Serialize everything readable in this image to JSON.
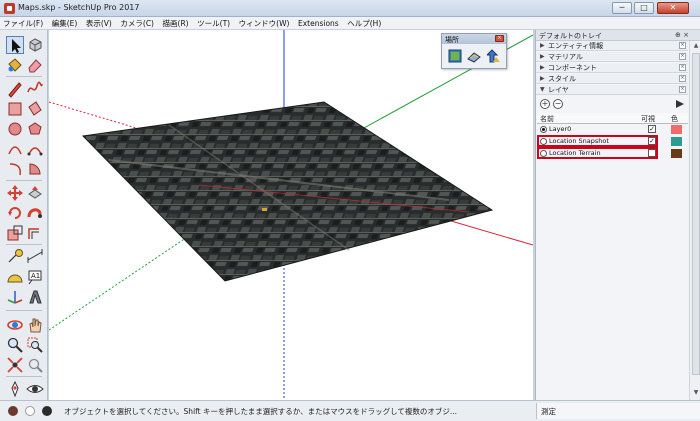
{
  "window": {
    "title": "Maps.skp - SketchUp Pro 2017",
    "buttons": {
      "minimize": "─",
      "maximize": "□",
      "close": "✕"
    }
  },
  "menu": [
    "ファイル(F)",
    "編集(E)",
    "表示(V)",
    "カメラ(C)",
    "描画(R)",
    "ツール(T)",
    "ウィンドウ(W)",
    "Extensions",
    "ヘルプ(H)"
  ],
  "toolbar": {
    "icons": [
      "select-arrow-icon",
      "component-icon",
      "paint-bucket-icon",
      "eraser-icon",
      "pencil-line-icon",
      "freehand-icon",
      "rectangle-icon",
      "rotated-rectangle-icon",
      "circle-icon",
      "polygon-icon",
      "arc-icon",
      "two-point-arc-icon",
      "pie-icon",
      "three-point-arc-icon",
      "move-icon",
      "push-pull-icon",
      "rotate-icon",
      "follow-me-icon",
      "scale-icon",
      "offset-icon",
      "tape-measure-icon",
      "dimension-icon",
      "protractor-icon",
      "text-icon",
      "axes-icon",
      "3d-text-icon",
      "orbit-icon",
      "pan-icon",
      "zoom-icon",
      "zoom-window-icon",
      "zoom-extents-icon",
      "previous-view-icon",
      "position-camera-icon",
      "look-around-icon"
    ]
  },
  "places_toolbar": {
    "title": "場所",
    "close": "×",
    "tools": [
      "add-location-icon",
      "photo-textures-icon",
      "toggle-terrain-icon"
    ]
  },
  "tray": {
    "title": "デフォルトのトレイ",
    "pin": "⊕ ×",
    "panels": [
      {
        "label": "エンティティ情報",
        "expanded": false
      },
      {
        "label": "マテリアル",
        "expanded": false
      },
      {
        "label": "コンポーネント",
        "expanded": false
      },
      {
        "label": "スタイル",
        "expanded": false
      },
      {
        "label": "レイヤ",
        "expanded": true
      }
    ],
    "arrow_collapsed": "▶",
    "arrow_expanded": "▼",
    "panel_close": "×"
  },
  "layers": {
    "add_icon": "+",
    "remove_icon": "−",
    "headers": {
      "name": "名前",
      "visible": "可視",
      "color": "色"
    },
    "rows": [
      {
        "name": "Layer0",
        "active": true,
        "visible": true,
        "color": "#f26b6b"
      },
      {
        "name": "Location Snapshot",
        "active": false,
        "visible": true,
        "color": "#2a9d8f"
      },
      {
        "name": "Location Terrain",
        "active": false,
        "visible": false,
        "color": "#6b3a16"
      }
    ],
    "checkmark": "✓"
  },
  "status": {
    "text": "オブジェクトを選択してください。Shift キーを押したまま選択するか、またはマウスをドラッグして複数のオブジ...",
    "measure_label": "測定"
  }
}
